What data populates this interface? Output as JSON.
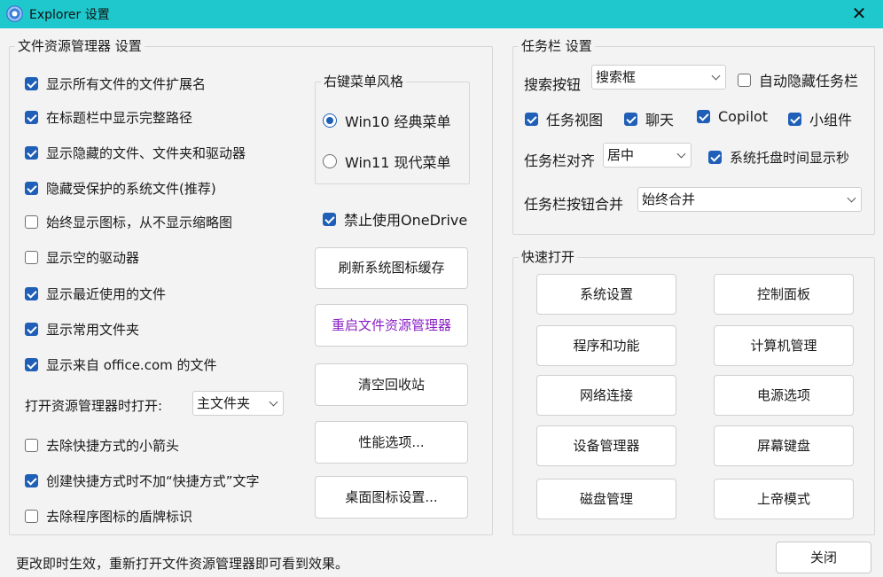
{
  "window": {
    "title": "Explorer 设置",
    "close_glyph": "✕"
  },
  "explorer_group": {
    "legend": "文件资源管理器 设置",
    "options": [
      {
        "label": "显示所有文件的文件扩展名",
        "checked": true
      },
      {
        "label": "在标题栏中显示完整路径",
        "checked": true
      },
      {
        "label": "显示隐藏的文件、文件夹和驱动器",
        "checked": true
      },
      {
        "label": "隐藏受保护的系统文件(推荐)",
        "checked": true
      },
      {
        "label": "始终显示图标，从不显示缩略图",
        "checked": false
      },
      {
        "label": "显示空的驱动器",
        "checked": false
      },
      {
        "label": "显示最近使用的文件",
        "checked": true
      },
      {
        "label": "显示常用文件夹",
        "checked": true
      },
      {
        "label": "显示来自 office.com 的文件",
        "checked": true
      }
    ],
    "open_label": "打开资源管理器时打开:",
    "open_value": "主文件夹",
    "options2": [
      {
        "label": "去除快捷方式的小箭头",
        "checked": false
      },
      {
        "label": "创建快捷方式时不加“快捷方式”文字",
        "checked": true
      },
      {
        "label": "去除程序图标的盾牌标识",
        "checked": false
      }
    ],
    "menu_style": {
      "legend": "右键菜单风格",
      "options": [
        {
          "label": "Win10 经典菜单",
          "selected": true
        },
        {
          "label": "Win11 现代菜单",
          "selected": false
        }
      ]
    },
    "onedrive": {
      "label": "禁止使用OneDrive",
      "checked": true
    },
    "buttons": [
      "刷新系统图标缓存",
      "重启文件资源管理器",
      "清空回收站",
      "性能选项...",
      "桌面图标设置..."
    ]
  },
  "taskbar_group": {
    "legend": "任务栏 设置",
    "search_label": "搜索按钮",
    "search_value": "搜索框",
    "autohide": {
      "label": "自动隐藏任务栏",
      "checked": false
    },
    "toggles": [
      {
        "label": "任务视图",
        "checked": true
      },
      {
        "label": "聊天",
        "checked": true
      },
      {
        "label": "Copilot",
        "checked": true
      },
      {
        "label": "小组件",
        "checked": true
      }
    ],
    "align_label": "任务栏对齐",
    "align_value": "居中",
    "seconds": {
      "label": "系统托盘时间显示秒",
      "checked": true
    },
    "combine_label": "任务栏按钮合并",
    "combine_value": "始终合并"
  },
  "quick_group": {
    "legend": "快速打开",
    "buttons": [
      "系统设置",
      "控制面板",
      "程序和功能",
      "计算机管理",
      "网络连接",
      "电源选项",
      "设备管理器",
      "屏幕键盘",
      "磁盘管理",
      "上帝模式"
    ]
  },
  "footer": {
    "note": "更改即时生效，重新打开文件资源管理器即可看到效果。",
    "close_label": "关闭"
  },
  "colors": {
    "titlebar": "#1ec8cc",
    "check_accent": "#1f5fb8",
    "restart_text": "#8a1fc4"
  }
}
